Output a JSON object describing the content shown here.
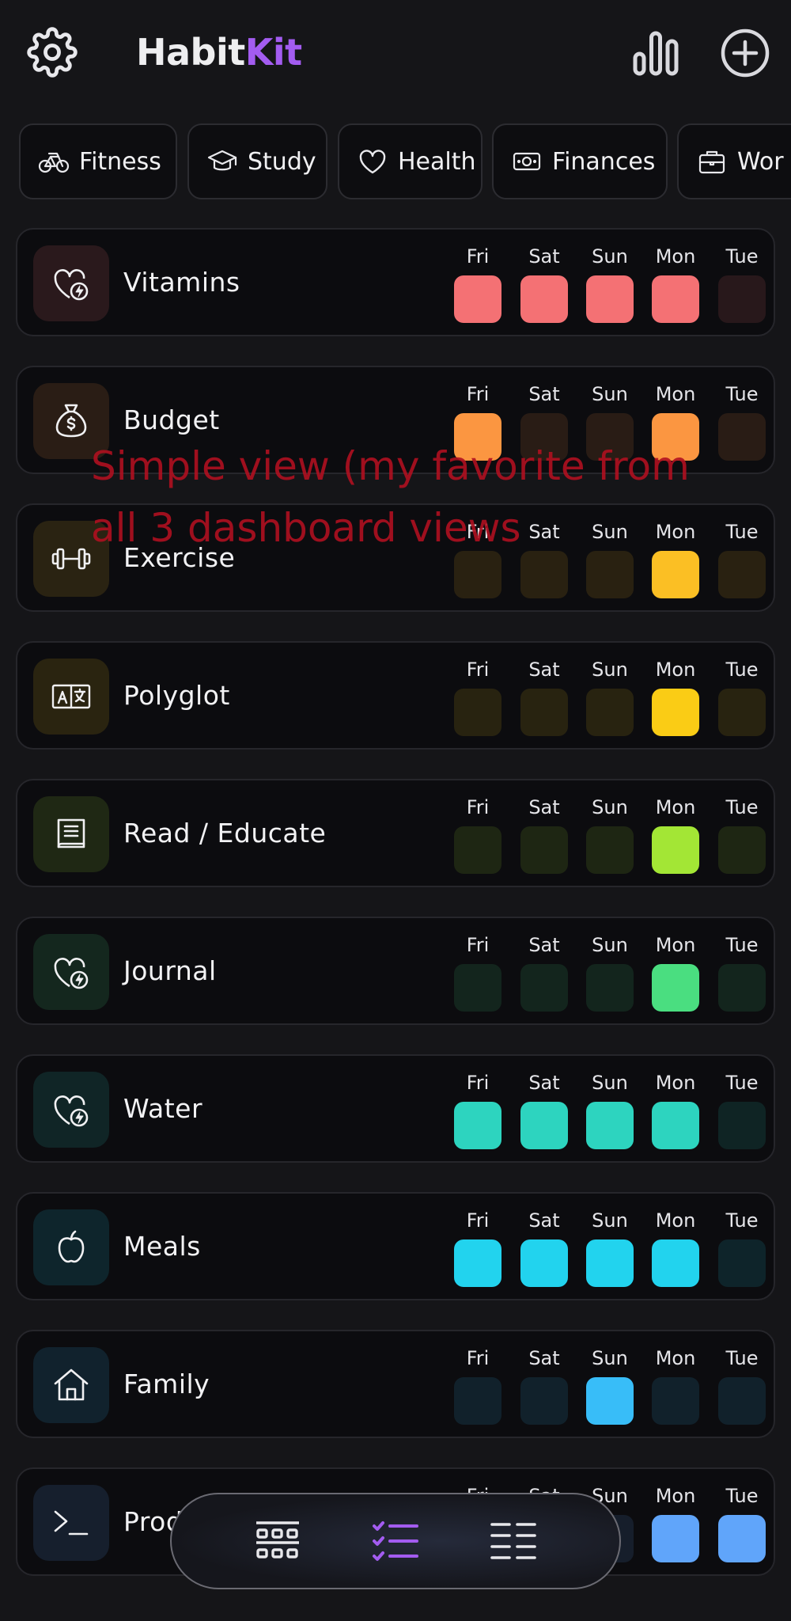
{
  "app": {
    "title_a": "Habit",
    "title_b": "Kit"
  },
  "header_icons": [
    "gear-icon",
    "bar-chart-icon",
    "plus-circle-icon"
  ],
  "categories": [
    {
      "label": "Fitness",
      "icon": "bicycle-icon"
    },
    {
      "label": "Study",
      "icon": "graduation-cap-icon"
    },
    {
      "label": "Health",
      "icon": "heart-icon"
    },
    {
      "label": "Finances",
      "icon": "money-icon"
    },
    {
      "label": "Wor",
      "icon": "briefcase-icon"
    }
  ],
  "days": [
    "Fri",
    "Sat",
    "Sun",
    "Mon",
    "Tue"
  ],
  "habits": [
    {
      "name": "Vitamins",
      "icon": "heart-bolt-icon",
      "color": "#f47174",
      "done": [
        true,
        true,
        true,
        true,
        false
      ]
    },
    {
      "name": "Budget",
      "icon": "money-bag-icon",
      "color": "#fb9641",
      "done": [
        true,
        false,
        false,
        true,
        false
      ]
    },
    {
      "name": "Exercise",
      "icon": "dumbbell-icon",
      "color": "#fbbf24",
      "done": [
        false,
        false,
        false,
        true,
        false
      ]
    },
    {
      "name": "Polyglot",
      "icon": "translate-icon",
      "color": "#facc15",
      "done": [
        false,
        false,
        false,
        true,
        false
      ]
    },
    {
      "name": "Read / Educate",
      "icon": "book-icon",
      "color": "#a3e635",
      "done": [
        false,
        false,
        false,
        true,
        false
      ]
    },
    {
      "name": "Journal",
      "icon": "heart-bolt-icon",
      "color": "#4ade80",
      "done": [
        false,
        false,
        false,
        true,
        false
      ]
    },
    {
      "name": "Water",
      "icon": "heart-bolt-icon",
      "color": "#2dd4bf",
      "done": [
        true,
        true,
        true,
        true,
        false
      ]
    },
    {
      "name": "Meals",
      "icon": "apple-icon",
      "color": "#22d3ee",
      "done": [
        true,
        true,
        true,
        true,
        false
      ]
    },
    {
      "name": "Family",
      "icon": "home-icon",
      "color": "#38bdf8",
      "done": [
        false,
        false,
        true,
        false,
        false
      ]
    },
    {
      "name": "Prod",
      "icon": "terminal-icon",
      "color": "#60a5fa",
      "done": [
        false,
        false,
        false,
        true,
        true
      ]
    }
  ],
  "overlay_text": "Simple view (my favorite from all 3 dashboard views",
  "bottom_nav": [
    {
      "icon": "grid-view-icon",
      "active": false
    },
    {
      "icon": "checklist-icon",
      "active": true
    },
    {
      "icon": "list-view-icon",
      "active": false
    }
  ],
  "colors": {
    "accent": "#a35cf0",
    "background": "#151518",
    "card": "#0c0c0f"
  }
}
